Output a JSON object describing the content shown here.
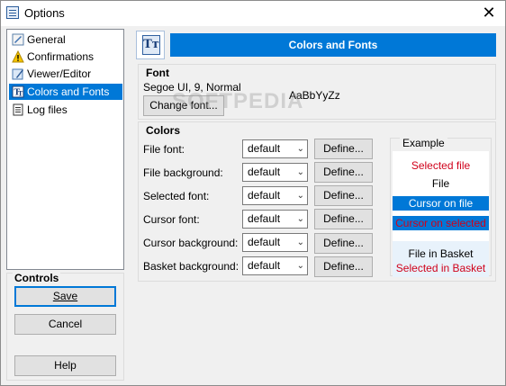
{
  "window": {
    "title": "Options",
    "close_glyph": "✕"
  },
  "nav": {
    "items": [
      {
        "label": "General",
        "icon": "general-icon"
      },
      {
        "label": "Confirmations",
        "icon": "warning-icon"
      },
      {
        "label": "Viewer/Editor",
        "icon": "viewer-icon"
      },
      {
        "label": "Colors and Fonts",
        "icon": "font-icon",
        "selected": true
      },
      {
        "label": "Log files",
        "icon": "log-icon"
      }
    ]
  },
  "controls": {
    "label": "Controls",
    "save": "Save",
    "cancel": "Cancel",
    "help": "Help"
  },
  "header": {
    "title": "Colors and Fonts",
    "icon_glyph": "Tт"
  },
  "font": {
    "group_label": "Font",
    "current": "Segoe UI, 9, Normal",
    "change_button": "Change font...",
    "preview": "AaBbYyZz"
  },
  "colors": {
    "group_label": "Colors",
    "define_label": "Define...",
    "rows": [
      {
        "label": "File font:",
        "value": "default"
      },
      {
        "label": "File background:",
        "value": "default"
      },
      {
        "label": "Selected font:",
        "value": "default"
      },
      {
        "label": "Cursor font:",
        "value": "default"
      },
      {
        "label": "Cursor background:",
        "value": "default"
      },
      {
        "label": "Basket background:",
        "value": "default"
      }
    ]
  },
  "example": {
    "label": "Example",
    "lines": [
      {
        "text": "Selected file",
        "color": "#d0021b",
        "bg": "#ffffff"
      },
      {
        "text": "File",
        "color": "#000000",
        "bg": "#ffffff"
      },
      {
        "text": "Cursor on file",
        "color": "#ffffff",
        "bg": "#0078d7"
      },
      {
        "text": "Cursor on selected",
        "color": "#d0021b",
        "bg": "#0078d7"
      },
      {
        "text": "File in Basket",
        "color": "#000000",
        "bg": "#e8f2fb"
      },
      {
        "text": "Selected in Basket",
        "color": "#d0021b",
        "bg": "#e8f2fb"
      }
    ]
  },
  "watermark": "SOFTPEDIA"
}
